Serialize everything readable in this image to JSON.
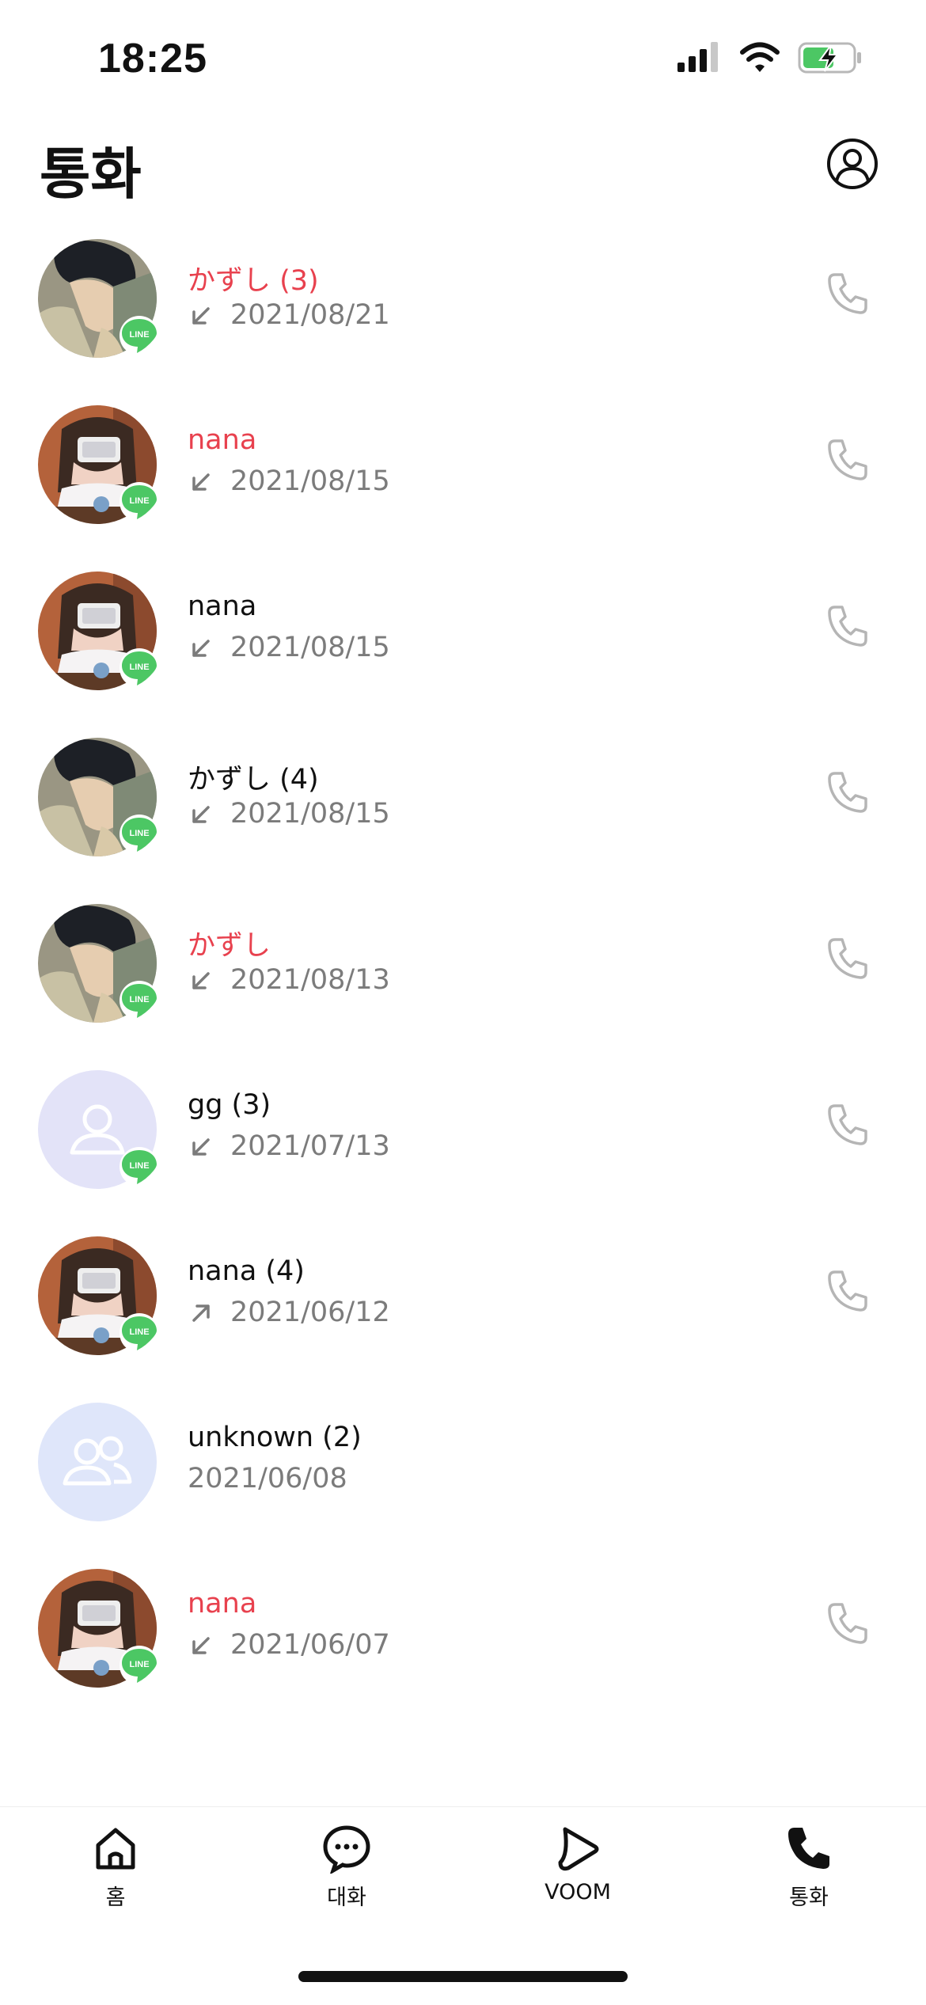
{
  "status_bar": {
    "time": "18:25"
  },
  "header": {
    "title": "통화",
    "profile_icon": "person-circle-icon"
  },
  "colors": {
    "missed": "#e8414e",
    "line_green": "#4cc764",
    "muted": "#7b7b7b"
  },
  "calls": [
    {
      "name": "かずし (3)",
      "missed": true,
      "direction": "incoming",
      "date": "2021/08/21",
      "avatar": "anime-boy",
      "badge": "LINE"
    },
    {
      "name": "nana",
      "missed": true,
      "direction": "incoming",
      "date": "2021/08/15",
      "avatar": "girl-phone",
      "badge": "LINE"
    },
    {
      "name": "nana",
      "missed": false,
      "direction": "incoming",
      "date": "2021/08/15",
      "avatar": "girl-phone",
      "badge": "LINE"
    },
    {
      "name": "かずし (4)",
      "missed": false,
      "direction": "incoming",
      "date": "2021/08/15",
      "avatar": "anime-boy",
      "badge": "LINE"
    },
    {
      "name": "かずし",
      "missed": true,
      "direction": "incoming",
      "date": "2021/08/13",
      "avatar": "anime-boy",
      "badge": "LINE"
    },
    {
      "name": "gg (3)",
      "missed": false,
      "direction": "incoming",
      "date": "2021/07/13",
      "avatar": "default-person",
      "badge": "LINE"
    },
    {
      "name": "nana (4)",
      "missed": false,
      "direction": "outgoing",
      "date": "2021/06/12",
      "avatar": "girl-phone",
      "badge": "LINE"
    },
    {
      "name": "unknown (2)",
      "missed": false,
      "direction": "none",
      "date": "2021/06/08",
      "avatar": "default-group",
      "badge": ""
    },
    {
      "name": "nana",
      "missed": true,
      "direction": "incoming",
      "date": "2021/06/07",
      "avatar": "girl-phone",
      "badge": "LINE"
    }
  ],
  "tabbar": [
    {
      "label": "홈",
      "icon": "home-icon"
    },
    {
      "label": "대화",
      "icon": "chat-icon"
    },
    {
      "label": "VOOM",
      "icon": "voom-play-icon"
    },
    {
      "label": "통화",
      "icon": "phone-filled-icon"
    }
  ]
}
